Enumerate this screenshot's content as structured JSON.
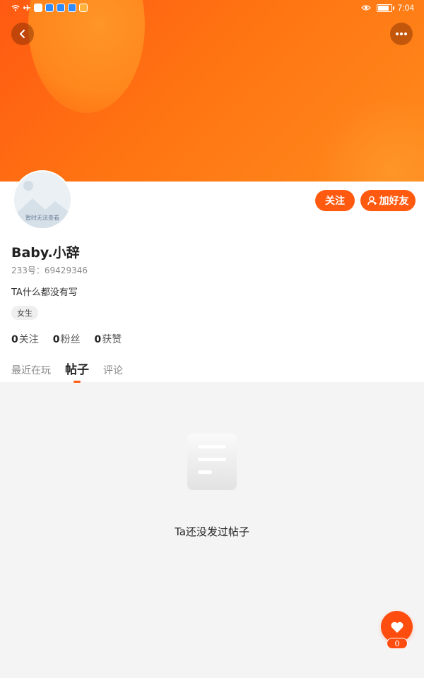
{
  "status_bar": {
    "time": "7:04",
    "battery_level": 0.85
  },
  "profile": {
    "avatar_text": "暂时无法查看",
    "follow_label": "关注",
    "add_friend_label": "加好友",
    "username": "Baby.小辞",
    "uid": "233号：69429346",
    "bio": "TA什么都没有写",
    "tag": "女生",
    "stats": [
      {
        "value": "0",
        "label": "关注"
      },
      {
        "value": "0",
        "label": "粉丝"
      },
      {
        "value": "0",
        "label": "获赞"
      }
    ]
  },
  "tabs": [
    {
      "label": "最近在玩",
      "active": false
    },
    {
      "label": "帖子",
      "active": true
    },
    {
      "label": "评论",
      "active": false
    }
  ],
  "empty_state": {
    "text": "Ta还没发过帖子"
  },
  "like": {
    "count": "0"
  },
  "colors": {
    "accent": "#ff5a0f",
    "banner_start": "#ff5a12",
    "banner_end": "#ff8a1c"
  },
  "icons": [
    "back-icon",
    "more-icon",
    "wifi-icon",
    "airplane-icon",
    "eye-icon",
    "add-friend-icon",
    "document-icon",
    "heart-icon"
  ]
}
